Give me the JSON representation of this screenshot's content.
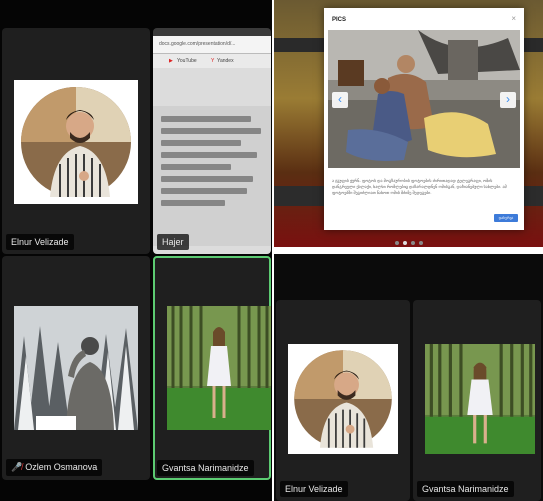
{
  "participants": {
    "top_left": {
      "name": "Elnur Velizade"
    },
    "top_right": {
      "name": "Hajer"
    },
    "bottom_left": {
      "name": "Ozlem Osmanova",
      "muted": true
    },
    "bottom_right": {
      "name": "Gvantsa Narimanidze"
    }
  },
  "browser": {
    "url": "docs.google.com/presentation/d/...",
    "bookmarks": [
      "YouTube",
      "Yandex"
    ]
  },
  "modal": {
    "title": "PICS",
    "close": "×",
    "description": "ა ჯგუფის ჟურნ- ფოტოს და მოგზაურობის ფოტოების ძირითადად ტელეგრაფი, ომის დანგრეული ქალაქი, ხალხი რომლებიც დაზარალდნენ ომისგან, დაზიანებული სახლები. ამ ფოტოებში შეგიძლიათ ნახოთ ომის მძიმე შედეგები.",
    "button": "დახურვა",
    "next_arrow": "›",
    "prev_arrow": "‹"
  },
  "pagination": {
    "count": 4,
    "active": 1
  },
  "lower_right": {
    "left": {
      "name": "Elnur Velizade"
    },
    "right": {
      "name": "Gvantsa Narimanidze"
    }
  },
  "colors": {
    "active_border": "#5ccb72",
    "tile_bg": "#1f1f1f",
    "mute_icon": "#e23b3b"
  }
}
